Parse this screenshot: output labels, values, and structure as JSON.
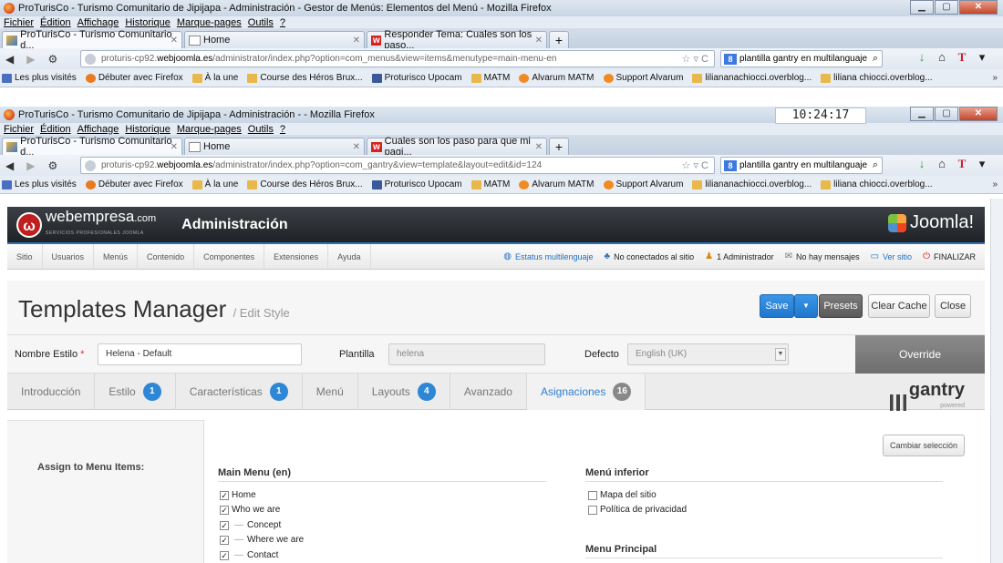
{
  "windows": [
    {
      "title": "ProTurisCo - Turismo Comunitario de Jipijapa - Administración - Gestor de Menús: Elementos del Menú - Mozilla Firefox",
      "tabs": [
        {
          "label": "ProTurisCo - Turismo Comunitario d..."
        },
        {
          "label": "Home"
        },
        {
          "label": "Responder Tema: Cuales son los paso..."
        }
      ],
      "url_prefix": "proturis-cp92.",
      "url_domain": "webjoomla.es",
      "url_path": "/administrator/index.php?option=com_menus&view=items&menutype=main-menu-en"
    },
    {
      "title": "ProTurisCo - Turismo Comunitario de Jipijapa - Administración - - Mozilla Firefox",
      "clock": "10:24:17",
      "tabs": [
        {
          "label": "ProTurisCo - Turismo Comunitario d..."
        },
        {
          "label": "Home"
        },
        {
          "label": "Cuales son los paso para que mi pagi..."
        }
      ],
      "url_prefix": "proturis-cp92.",
      "url_domain": "webjoomla.es",
      "url_path": "/administrator/index.php?option=com_gantry&view=template&layout=edit&id=124"
    }
  ],
  "browser": {
    "menu": [
      "Fichier",
      "Édition",
      "Affichage",
      "Historique",
      "Marque-pages",
      "Outils",
      "?"
    ],
    "search_text": "plantilla gantry en multilanguaje",
    "bookmarks": [
      "Les plus visités",
      "Débuter avec Firefox",
      "À la une",
      "Course des Héros Brux...",
      "Proturisco Upocam",
      "MATM",
      "Alvarum MATM",
      "Support Alvarum",
      "liliananachiocci.overblog...",
      "liliana chiocci.overblog..."
    ],
    "bookmarks_more": "»"
  },
  "joomla": {
    "brand": "webempresa",
    "brand_suffix": ".com",
    "brand_tagline": "SERVICIOS PROFESIONALES JOOMLA",
    "admin_title": "Administración",
    "joomla_logo": "Joomla!",
    "menu": [
      "Sitio",
      "Usuarios",
      "Menús",
      "Contenido",
      "Componentes",
      "Extensiones",
      "Ayuda"
    ],
    "status": [
      {
        "label": "Estatus multilenguaje",
        "icon": "globe-icon"
      },
      {
        "label": "No conectados al sitio",
        "icon": "users-icon"
      },
      {
        "label": "1 Administrador",
        "icon": "user-icon"
      },
      {
        "label": "No hay mensajes",
        "icon": "mail-icon"
      },
      {
        "label": "Ver sitio",
        "icon": "screen-icon"
      },
      {
        "label": "FINALIZAR",
        "icon": "power-icon"
      }
    ],
    "page_title": "Templates Manager",
    "page_subtitle": "/ Edit Style",
    "buttons": {
      "save": "Save",
      "presets": "Presets",
      "clear_cache": "Clear Cache",
      "close": "Close",
      "override": "Override",
      "cambiar": "Cambiar selección"
    },
    "fields": {
      "nombre_label": "Nombre Estilo",
      "nombre_value": "Helena - Default",
      "plantilla_label": "Plantilla",
      "plantilla_value": "helena",
      "defecto_label": "Defecto",
      "defecto_value": "English (UK)"
    },
    "tabs": [
      {
        "label": "Introducción",
        "badge": ""
      },
      {
        "label": "Estilo",
        "badge": "1"
      },
      {
        "label": "Características",
        "badge": "1"
      },
      {
        "label": "Menú",
        "badge": ""
      },
      {
        "label": "Layouts",
        "badge": "4"
      },
      {
        "label": "Avanzado",
        "badge": ""
      },
      {
        "label": "Asignaciones",
        "badge": "16"
      }
    ],
    "gantry_label": "gantry",
    "gantry_sub": "powered",
    "assign_label": "Assign to Menu Items:",
    "main_menu": {
      "title": "Main Menu (en)",
      "items": [
        {
          "label": "Home",
          "checked": true,
          "child": false
        },
        {
          "label": "Who we are",
          "checked": true,
          "child": false
        },
        {
          "label": "Concept",
          "checked": true,
          "child": true
        },
        {
          "label": "Where we are",
          "checked": true,
          "child": true
        },
        {
          "label": "Contact",
          "checked": true,
          "child": true
        }
      ]
    },
    "menu_inferior": {
      "title": "Menú inferior",
      "items": [
        {
          "label": "Mapa del sitio",
          "checked": false
        },
        {
          "label": "Política de privacidad",
          "checked": false
        }
      ]
    },
    "menu_principal_title": "Menu Principal"
  }
}
